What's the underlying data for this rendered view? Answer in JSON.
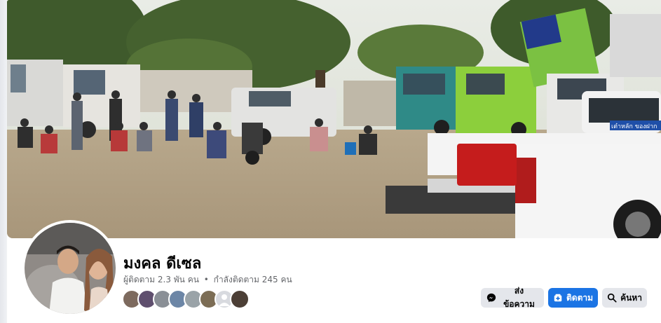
{
  "page": {
    "name": "มงคล ดีเซล",
    "followers_text": "ผู้ติดตาม 2.3 พัน คน",
    "separator": "•",
    "following_text": "กำลังติดตาม 245 คน"
  },
  "actions": {
    "message_label": "ส่งข้อความ",
    "follow_label": "ติดตาม",
    "search_label": "ค้นหา"
  },
  "cover": {
    "truck_sign_text": "เต๋าหลัก ของฝาก"
  },
  "colors": {
    "brand_blue": "#1b74e4",
    "secondary_button": "#e4e6eb",
    "text_primary": "#050505",
    "text_secondary": "#65676b"
  },
  "icons": {
    "message": "messenger-icon",
    "follow": "follow-icon",
    "search": "search-icon"
  }
}
